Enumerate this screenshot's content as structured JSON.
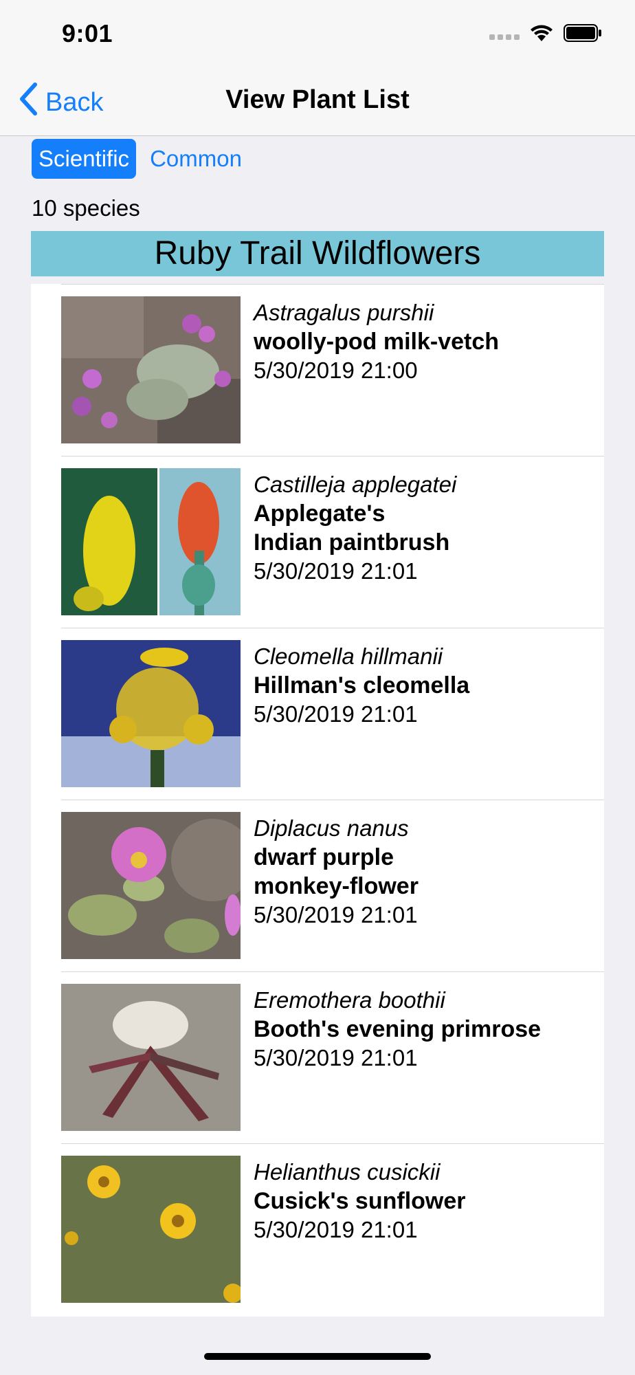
{
  "status": {
    "time": "9:01"
  },
  "nav": {
    "back_label": "Back",
    "title": "View Plant List"
  },
  "segments": {
    "scientific": "Scientific",
    "common": "Common"
  },
  "species_count": "10 species",
  "list_header": "Ruby Trail Wildflowers",
  "plants": [
    {
      "scientific": "Astragalus purshii",
      "common": "woolly-pod milk-vetch",
      "date": "5/30/2019 21:00"
    },
    {
      "scientific": "Castilleja applegatei",
      "common": "Applegate's\nIndian paintbrush",
      "date": "5/30/2019 21:01"
    },
    {
      "scientific": "Cleomella hillmanii",
      "common": "Hillman's cleomella",
      "date": "5/30/2019 21:01"
    },
    {
      "scientific": "Diplacus nanus",
      "common": "dwarf purple\nmonkey-flower",
      "date": "5/30/2019 21:01"
    },
    {
      "scientific": "Eremothera boothii",
      "common": "Booth's evening primrose",
      "date": "5/30/2019 21:01"
    },
    {
      "scientific": "Helianthus cusickii",
      "common": "Cusick's sunflower",
      "date": "5/30/2019 21:01"
    }
  ]
}
